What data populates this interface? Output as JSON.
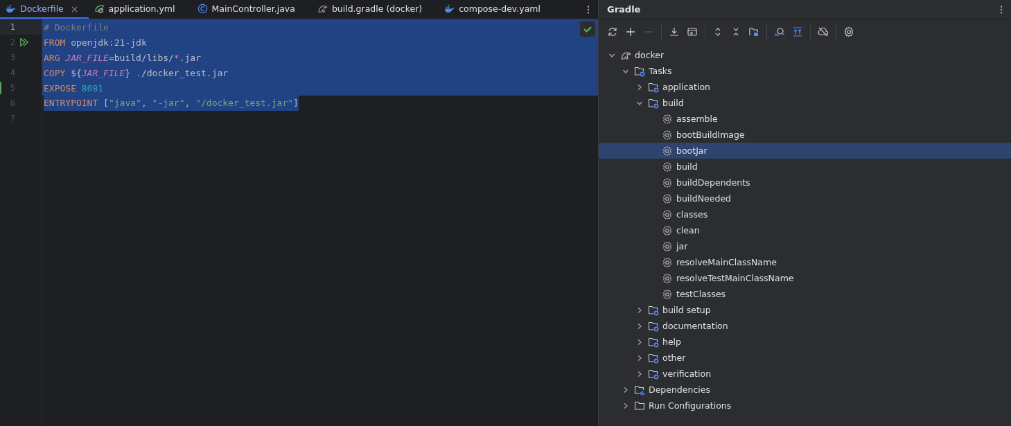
{
  "tabs": [
    {
      "label": "Dockerfile",
      "kind": "docker",
      "selected": true,
      "closable": true
    },
    {
      "label": "application.yml",
      "kind": "spring",
      "selected": false,
      "closable": false
    },
    {
      "label": "MainController.java",
      "kind": "class",
      "selected": false,
      "closable": false
    },
    {
      "label": "build.gradle (docker)",
      "kind": "gradle",
      "selected": false,
      "closable": false
    },
    {
      "label": "compose-dev.yaml",
      "kind": "docker",
      "selected": false,
      "closable": false
    }
  ],
  "close_glyph": "×",
  "editor": {
    "lines": [
      {
        "number": "1",
        "current": true,
        "selected": true,
        "full_width": true,
        "run_marker": false,
        "changed": false,
        "tokens": [
          {
            "kind": "comment",
            "text": "# Dockerfile"
          }
        ]
      },
      {
        "number": "2",
        "current": false,
        "selected": true,
        "full_width": true,
        "run_marker": true,
        "changed": false,
        "tokens": [
          {
            "kind": "keyword",
            "text": "FROM"
          },
          {
            "kind": "plain",
            "text": " openjdk:21-jdk"
          }
        ]
      },
      {
        "number": "3",
        "current": false,
        "selected": true,
        "full_width": true,
        "run_marker": false,
        "changed": false,
        "tokens": [
          {
            "kind": "keyword",
            "text": "ARG "
          },
          {
            "kind": "variable",
            "text": "JAR_FILE"
          },
          {
            "kind": "plain",
            "text": "=build/libs/"
          },
          {
            "kind": "variable",
            "text": "*"
          },
          {
            "kind": "plain",
            "text": ".jar"
          }
        ]
      },
      {
        "number": "4",
        "current": false,
        "selected": true,
        "full_width": true,
        "run_marker": false,
        "changed": false,
        "tokens": [
          {
            "kind": "keyword",
            "text": "COPY"
          },
          {
            "kind": "plain",
            "text": " ${"
          },
          {
            "kind": "variable",
            "text": "JAR_FILE"
          },
          {
            "kind": "plain",
            "text": "} ./docker_test.jar"
          }
        ]
      },
      {
        "number": "5",
        "current": false,
        "selected": true,
        "full_width": true,
        "run_marker": false,
        "changed": true,
        "tokens": [
          {
            "kind": "keyword",
            "text": "EXPOSE "
          },
          {
            "kind": "number",
            "text": "8081"
          }
        ]
      },
      {
        "number": "6",
        "current": false,
        "selected": true,
        "full_width": false,
        "run_marker": false,
        "changed": false,
        "tokens": [
          {
            "kind": "keyword",
            "text": "ENTRYPOINT"
          },
          {
            "kind": "plain",
            "text": " ["
          },
          {
            "kind": "string",
            "text": "\"java\""
          },
          {
            "kind": "plain",
            "text": ", "
          },
          {
            "kind": "string",
            "text": "\"-jar\""
          },
          {
            "kind": "plain",
            "text": ", "
          },
          {
            "kind": "string",
            "text": "\"/docker_test.jar\""
          },
          {
            "kind": "plain",
            "text": "]"
          }
        ]
      },
      {
        "number": "7",
        "current": false,
        "selected": false,
        "run_marker": false,
        "changed": false
      }
    ]
  },
  "gradle": {
    "title": "Gradle",
    "tree": [
      {
        "label": "docker",
        "kind": "project",
        "expanded": true,
        "selected": false,
        "children": [
          {
            "label": "Tasks",
            "kind": "folder",
            "expanded": true,
            "selected": false,
            "children": [
              {
                "label": "application",
                "kind": "folder",
                "expanded": false,
                "selected": false
              },
              {
                "label": "build",
                "kind": "folder",
                "expanded": true,
                "selected": false,
                "children": [
                  {
                    "label": "assemble",
                    "kind": "task",
                    "selected": false
                  },
                  {
                    "label": "bootBuildImage",
                    "kind": "task",
                    "selected": false
                  },
                  {
                    "label": "bootJar",
                    "kind": "task",
                    "selected": true
                  },
                  {
                    "label": "build",
                    "kind": "task",
                    "selected": false
                  },
                  {
                    "label": "buildDependents",
                    "kind": "task",
                    "selected": false
                  },
                  {
                    "label": "buildNeeded",
                    "kind": "task",
                    "selected": false
                  },
                  {
                    "label": "classes",
                    "kind": "task",
                    "selected": false
                  },
                  {
                    "label": "clean",
                    "kind": "task",
                    "selected": false
                  },
                  {
                    "label": "jar",
                    "kind": "task",
                    "selected": false
                  },
                  {
                    "label": "resolveMainClassName",
                    "kind": "task",
                    "selected": false
                  },
                  {
                    "label": "resolveTestMainClassName",
                    "kind": "task",
                    "selected": false
                  },
                  {
                    "label": "testClasses",
                    "kind": "task",
                    "selected": false
                  }
                ]
              },
              {
                "label": "build setup",
                "kind": "folder",
                "expanded": false,
                "selected": false
              },
              {
                "label": "documentation",
                "kind": "folder",
                "expanded": false,
                "selected": false
              },
              {
                "label": "help",
                "kind": "folder",
                "expanded": false,
                "selected": false
              },
              {
                "label": "other",
                "kind": "folder",
                "expanded": false,
                "selected": false
              },
              {
                "label": "verification",
                "kind": "folder",
                "expanded": false,
                "selected": false
              }
            ]
          },
          {
            "label": "Dependencies",
            "kind": "deps",
            "expanded": false,
            "selected": false
          },
          {
            "label": "Run Configurations",
            "kind": "folder-plain",
            "expanded": false,
            "selected": false
          }
        ]
      }
    ]
  }
}
